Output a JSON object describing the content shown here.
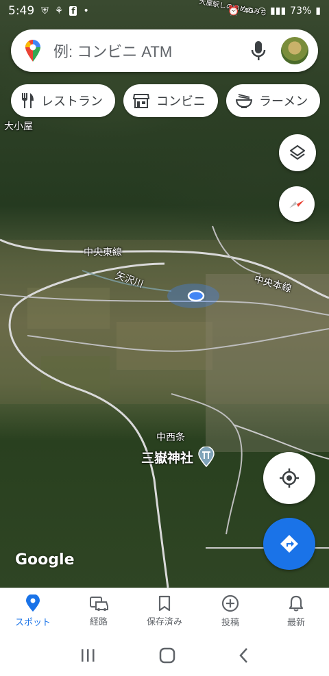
{
  "status_bar": {
    "time": "5:49",
    "battery": "73%"
  },
  "search": {
    "placeholder": "例: コンビニ ATM"
  },
  "chips": [
    {
      "label": "レストラン",
      "icon": "fork-knife-icon"
    },
    {
      "label": "コンビニ",
      "icon": "store-icon"
    },
    {
      "label": "ラーメン",
      "icon": "ramen-bowl-icon"
    }
  ],
  "map": {
    "labels": {
      "place1": "大小屋",
      "line1": "中央東線",
      "river": "矢沢川",
      "line2": "中央本線",
      "area": "中西条",
      "shrine": "三嶽神社",
      "road_top": "大屋駅しののめのみち"
    },
    "logo": "Google"
  },
  "bottom_nav": [
    {
      "label": "スポット",
      "icon": "location-pin-icon",
      "active": true
    },
    {
      "label": "経路",
      "icon": "car-icon",
      "active": false
    },
    {
      "label": "保存済み",
      "icon": "bookmark-icon",
      "active": false
    },
    {
      "label": "投稿",
      "icon": "add-circle-icon",
      "active": false
    },
    {
      "label": "最新",
      "icon": "bell-icon",
      "active": false
    }
  ],
  "colors": {
    "accent": "#1a73e8",
    "location_dot": "#4285f4"
  }
}
